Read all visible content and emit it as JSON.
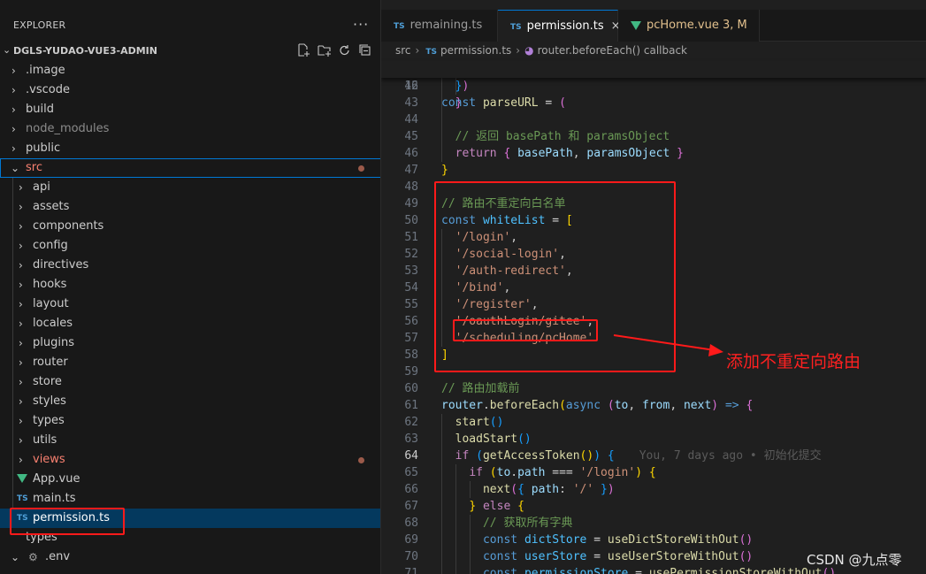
{
  "explorer": {
    "title": "EXPLORER",
    "more": "···",
    "project": "DGLS-YUDAO-VUE3-ADMIN",
    "items": [
      {
        "label": ".image",
        "type": "folder",
        "depth": 0
      },
      {
        "label": ".vscode",
        "type": "folder",
        "depth": 0
      },
      {
        "label": "build",
        "type": "folder",
        "depth": 0
      },
      {
        "label": "node_modules",
        "type": "folder",
        "depth": 0,
        "dim": true
      },
      {
        "label": "public",
        "type": "folder",
        "depth": 0
      },
      {
        "label": "src",
        "type": "folder-open",
        "depth": 0,
        "status": "error"
      },
      {
        "label": "api",
        "type": "folder",
        "depth": 1
      },
      {
        "label": "assets",
        "type": "folder",
        "depth": 1
      },
      {
        "label": "components",
        "type": "folder",
        "depth": 1
      },
      {
        "label": "config",
        "type": "folder",
        "depth": 1
      },
      {
        "label": "directives",
        "type": "folder",
        "depth": 1
      },
      {
        "label": "hooks",
        "type": "folder",
        "depth": 1
      },
      {
        "label": "layout",
        "type": "folder",
        "depth": 1
      },
      {
        "label": "locales",
        "type": "folder",
        "depth": 1
      },
      {
        "label": "plugins",
        "type": "folder",
        "depth": 1
      },
      {
        "label": "router",
        "type": "folder",
        "depth": 1
      },
      {
        "label": "store",
        "type": "folder",
        "depth": 1
      },
      {
        "label": "styles",
        "type": "folder",
        "depth": 1
      },
      {
        "label": "types",
        "type": "folder",
        "depth": 1
      },
      {
        "label": "utils",
        "type": "folder",
        "depth": 1
      },
      {
        "label": "views",
        "type": "folder",
        "depth": 1,
        "status": "error"
      },
      {
        "label": "App.vue",
        "type": "vue",
        "depth": 1
      },
      {
        "label": "main.ts",
        "type": "ts",
        "depth": 1
      },
      {
        "label": "permission.ts",
        "type": "ts",
        "depth": 1,
        "active": true
      },
      {
        "label": "types",
        "type": "folder-plain",
        "depth": 0
      },
      {
        "label": ".env",
        "type": "env",
        "depth": 0
      }
    ]
  },
  "tabs": [
    {
      "icon": "TS",
      "label": "remaining.ts"
    },
    {
      "icon": "TS",
      "label": "permission.ts",
      "active": true,
      "close": "×"
    },
    {
      "icon": "vue",
      "label": "pcHome.vue",
      "badge": "3, M"
    }
  ],
  "breadcrumb": {
    "root": "src",
    "file": "permission.ts",
    "symbol": "router.beforeEach() callback"
  },
  "sticky": {
    "num": "16",
    "code": "const parseURL = ("
  },
  "code_lines": [
    {
      "num": "42",
      "text": "  })"
    },
    {
      "num": "43",
      "text": "  }"
    },
    {
      "num": "44",
      "text": ""
    },
    {
      "num": "45",
      "text": "  // 返回 basePath 和 paramsObject"
    },
    {
      "num": "46",
      "text": "  return { basePath, paramsObject }"
    },
    {
      "num": "47",
      "text": "}"
    },
    {
      "num": "48",
      "text": ""
    },
    {
      "num": "49",
      "text": "// 路由不重定向白名单"
    },
    {
      "num": "50",
      "text": "const whiteList = ["
    },
    {
      "num": "51",
      "text": "  '/login',"
    },
    {
      "num": "52",
      "text": "  '/social-login',"
    },
    {
      "num": "53",
      "text": "  '/auth-redirect',"
    },
    {
      "num": "54",
      "text": "  '/bind',"
    },
    {
      "num": "55",
      "text": "  '/register',"
    },
    {
      "num": "56",
      "text": "  '/oauthLogin/gitee',"
    },
    {
      "num": "57",
      "text": "  '/scheduling/pcHome'"
    },
    {
      "num": "58",
      "text": "]"
    },
    {
      "num": "59",
      "text": ""
    },
    {
      "num": "60",
      "text": "// 路由加载前"
    },
    {
      "num": "61",
      "text": "router.beforeEach(async (to, from, next) => {"
    },
    {
      "num": "62",
      "text": "  start()"
    },
    {
      "num": "63",
      "text": "  loadStart()"
    },
    {
      "num": "64",
      "text": "  if (getAccessToken()) {",
      "blame": "You, 7 days ago • 初始化提交"
    },
    {
      "num": "65",
      "text": "    if (to.path === '/login') {"
    },
    {
      "num": "66",
      "text": "      next({ path: '/' })"
    },
    {
      "num": "67",
      "text": "    } else {"
    },
    {
      "num": "68",
      "text": "      // 获取所有字典"
    },
    {
      "num": "69",
      "text": "      const dictStore = useDictStoreWithOut()"
    },
    {
      "num": "70",
      "text": "      const userStore = useUserStoreWithOut()"
    },
    {
      "num": "71",
      "text": "      const permissionStore = usePermissionStoreWithOut()"
    }
  ],
  "annotation": "添加不重定向路由",
  "watermark": "CSDN @九点零",
  "colors": {
    "annotation_red": "#ff1a1a",
    "accent": "#0078d4",
    "active_row": "#04395e"
  }
}
